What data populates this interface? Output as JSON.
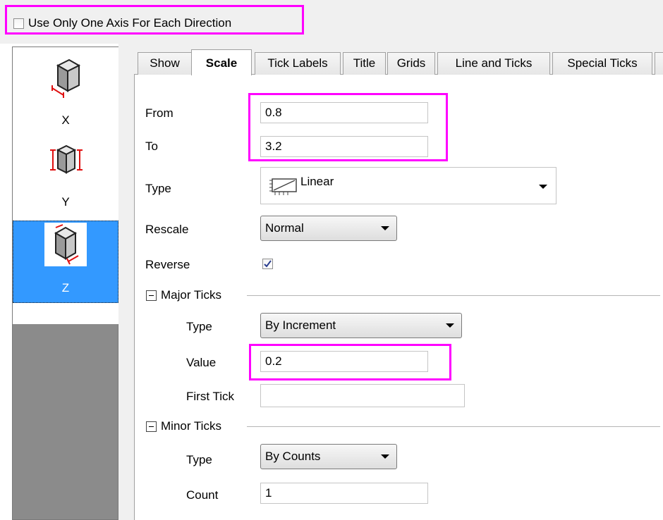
{
  "top": {
    "one_axis_label": "Use Only One Axis For Each Direction",
    "one_axis_checked": false
  },
  "axes": [
    {
      "label": "X",
      "icon": "cube-x-axis-icon",
      "selected": false
    },
    {
      "label": "Y",
      "icon": "cube-y-axis-icon",
      "selected": false
    },
    {
      "label": "Z",
      "icon": "cube-z-axis-icon",
      "selected": true
    }
  ],
  "tabs": [
    {
      "label": "Show",
      "active": false
    },
    {
      "label": "Scale",
      "active": true
    },
    {
      "label": "Tick Labels",
      "active": false
    },
    {
      "label": "Title",
      "active": false
    },
    {
      "label": "Grids",
      "active": false
    },
    {
      "label": "Line and Ticks",
      "active": false
    },
    {
      "label": "Special Ticks",
      "active": false
    }
  ],
  "scale": {
    "from_label": "From",
    "from_value": "0.8",
    "to_label": "To",
    "to_value": "3.2",
    "type_label": "Type",
    "type_value": "Linear",
    "type_icon": "linear-scale-icon",
    "rescale_label": "Rescale",
    "rescale_value": "Normal",
    "reverse_label": "Reverse",
    "reverse_checked": true
  },
  "major_ticks": {
    "section_label": "Major Ticks",
    "type_label": "Type",
    "type_value": "By Increment",
    "value_label": "Value",
    "value_value": "0.2",
    "first_tick_label": "First Tick",
    "first_tick_value": ""
  },
  "minor_ticks": {
    "section_label": "Minor Ticks",
    "type_label": "Type",
    "type_value": "By Counts",
    "count_label": "Count",
    "count_value": "1"
  },
  "colors": {
    "highlight": "#ff00ff",
    "selection": "#3399ff",
    "panel_gray": "#8b8b8b"
  }
}
